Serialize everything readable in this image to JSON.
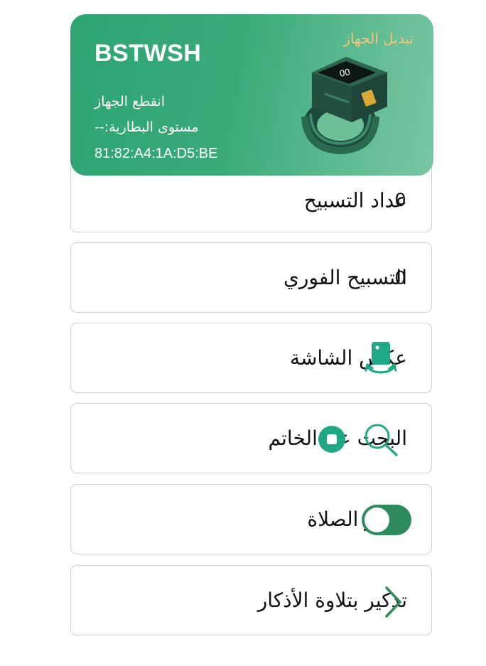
{
  "device": {
    "name": "BSTWSH",
    "status": "انقطع الجهاز",
    "battery": "مستوى البطارية:--",
    "mac": "81:82:A4:1A:D5:BE",
    "switch_label": "تبديل الجهاز",
    "ring_display": "00"
  },
  "rows": [
    {
      "label": "عداد التسبيح",
      "value": "0"
    },
    {
      "label": "التسبيح الفوري",
      "value": "0"
    },
    {
      "label": "عكس الشاشة",
      "icon": "screen-flip-icon"
    },
    {
      "label": "البحث عن الخاتم",
      "icons": [
        "search-icon",
        "stop-icon"
      ]
    },
    {
      "label": "تذكير الصلاة",
      "toggle_on": true
    },
    {
      "label": "تذكير بتلاوة الأذكار",
      "icon": "chevron-right-icon"
    }
  ],
  "colors": {
    "accent": "#2ea473",
    "switch_label": "#f2c77a",
    "toggle": "#2f8a5d",
    "icon": "#1fa886"
  }
}
